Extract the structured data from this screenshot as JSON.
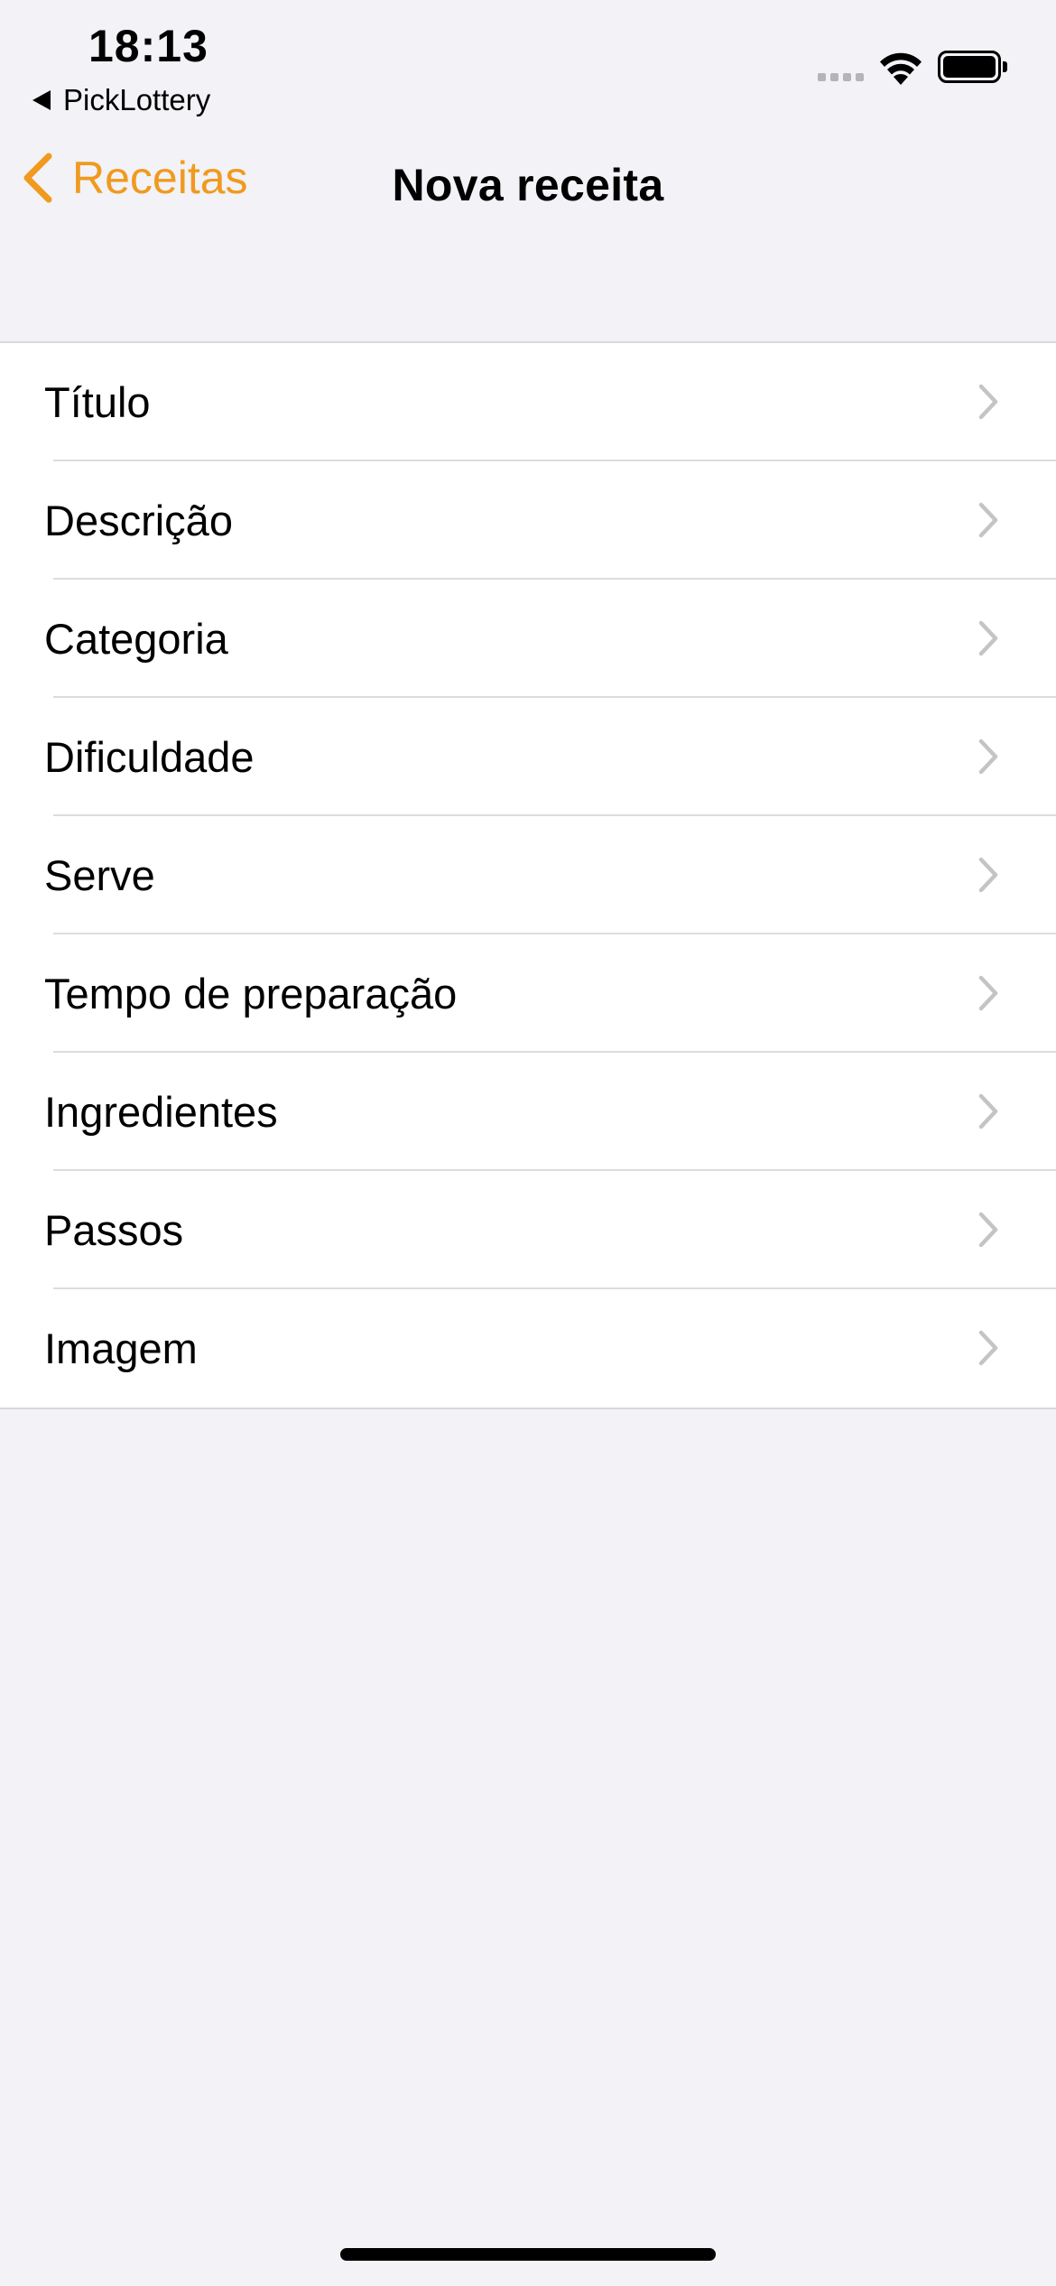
{
  "status_bar": {
    "time": "18:13",
    "back_app": "PickLottery"
  },
  "nav": {
    "back_label": "Receitas",
    "title": "Nova receita"
  },
  "colors": {
    "accent": "#f09a1e",
    "background": "#f2f2f7",
    "row_background": "#ffffff",
    "chevron": "#c4c4c7"
  },
  "form": {
    "rows": [
      {
        "label": "Título"
      },
      {
        "label": "Descrição"
      },
      {
        "label": "Categoria"
      },
      {
        "label": "Dificuldade"
      },
      {
        "label": "Serve"
      },
      {
        "label": "Tempo de preparação"
      },
      {
        "label": "Ingredientes"
      },
      {
        "label": "Passos"
      },
      {
        "label": "Imagem"
      }
    ]
  }
}
